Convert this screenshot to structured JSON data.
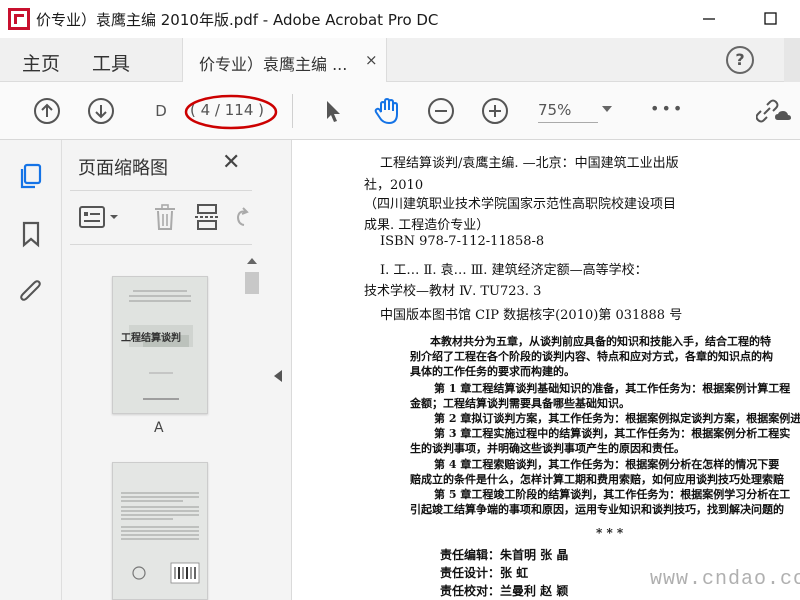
{
  "window": {
    "title": "价专业）袁鹰主编 2010年版.pdf - Adobe Acrobat Pro DC",
    "min_icon": "minimize-icon",
    "max_icon": "maximize-icon"
  },
  "tabs": {
    "home": "主页",
    "tools": "工具",
    "document": "价专业）袁鹰主编 ...",
    "close": "×",
    "help": "?"
  },
  "toolbar": {
    "page_input": "D",
    "page_count": "( 4 / 114 )",
    "zoom": "75%",
    "more": "•••"
  },
  "panel": {
    "title": "页面缩略图",
    "close": "✕",
    "thumbnails": [
      {
        "label": "A",
        "book_title": "工程结算谈判"
      },
      {
        "label": ""
      }
    ]
  },
  "document": {
    "lines": [
      "工程结算谈判/袁鹰主编. —北京：中国建筑工业出版",
      "社，2010",
      "（四川建筑职业技术学院国家示范性高职院校建设项目",
      "成果. 工程造价专业）",
      "ISBN 978-7-112-11858-8",
      "Ⅰ. 工…   Ⅱ. 袁…   Ⅲ. 建筑经济定额—高等学校：",
      "技术学校—教材   Ⅳ. TU723. 3",
      "中国版本图书馆 CIP 数据核字(2010)第 031888 号",
      "本教材共分为五章，从谈判前应具备的知识和技能入手，结合工程的特",
      "别介绍了工程在各个阶段的谈判内容、特点和应对方式，各章的知识点的构",
      "具体的工作任务的要求而构建的。",
      "第 1 章工程结算谈判基础知识的准备，其工作任务为：根据案例计算工程",
      "金额；工程结算谈判需要具备哪些基础知识。",
      "第 2 章拟订谈判方案，其工作任务为：根据案例拟定谈判方案，根据案例进",
      "第 3 章工程实施过程中的结算谈判，其工作任务为：根据案例分析工程实",
      "生的谈判事项，并明确这些谈判事项产生的原因和责任。",
      "第 4 章工程索赔谈判，其工作任务为：根据案例分析在怎样的情况下要",
      "赔成立的条件是什么，怎样计算工期和费用索赔，如何应用谈判技巧处理索赔",
      "第 5 章工程竣工阶段的结算谈判，其工作任务为：根据案例学习分析在工",
      "引起竣工结算争端的事项和原因，运用专业知识和谈判技巧，找到解决问题的",
      "*          *          *",
      "责任编辑：朱首明    张  晶",
      "责任设计：张  虹",
      "责任校对：兰曼利    赵  颖"
    ]
  },
  "watermark": "www.cndao.com",
  "colors": {
    "accent": "#1473e6",
    "annotation": "#cc0000"
  }
}
